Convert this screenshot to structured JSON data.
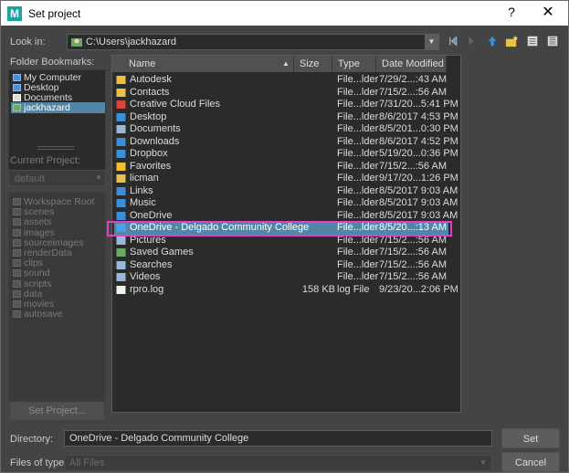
{
  "window": {
    "title": "Set project",
    "app_icon_letter": "M",
    "help": "?",
    "close": "✕"
  },
  "look_in": {
    "label": "Look in:",
    "path": "C:\\Users\\jackhazard"
  },
  "bookmarks": {
    "label": "Folder Bookmarks:",
    "items": [
      {
        "label": "My Computer"
      },
      {
        "label": "Desktop"
      },
      {
        "label": "Documents"
      },
      {
        "label": "jackhazard"
      }
    ]
  },
  "current_project": {
    "label": "Current Project:",
    "value": "default"
  },
  "workspace_items": [
    {
      "label": "Workspace Root"
    },
    {
      "label": "scenes"
    },
    {
      "label": "assets"
    },
    {
      "label": "images"
    },
    {
      "label": "sourceimages"
    },
    {
      "label": "renderData"
    },
    {
      "label": "clips"
    },
    {
      "label": "sound"
    },
    {
      "label": "scripts"
    },
    {
      "label": "data"
    },
    {
      "label": "movies"
    },
    {
      "label": "autosave"
    }
  ],
  "set_project_button": "Set Project...",
  "columns": {
    "name": "Name",
    "size": "Size",
    "type": "Type",
    "modified": "Date Modified"
  },
  "files": [
    {
      "name": "Autodesk",
      "size": "",
      "type": "File...lder",
      "date": "7/29/2...:43 AM",
      "icon": "#e8c04a"
    },
    {
      "name": "Contacts",
      "size": "",
      "type": "File...lder",
      "date": "7/15/2...:56 AM",
      "icon": "#e8c04a"
    },
    {
      "name": "Creative Cloud Files",
      "size": "",
      "type": "File...lder",
      "date": "7/31/20...5:41 PM",
      "icon": "#d8443a"
    },
    {
      "name": "Desktop",
      "size": "",
      "type": "File...lder",
      "date": "8/6/2017 4:53 PM",
      "icon": "#3a8fd8"
    },
    {
      "name": "Documents",
      "size": "",
      "type": "File...lder",
      "date": "8/5/201...0:30 PM",
      "icon": "#9ab8d8"
    },
    {
      "name": "Downloads",
      "size": "",
      "type": "File...lder",
      "date": "8/6/2017 4:52 PM",
      "icon": "#3a8fd8"
    },
    {
      "name": "Dropbox",
      "size": "",
      "type": "File...lder",
      "date": "5/19/20...0:36 PM",
      "icon": "#3a8fd8"
    },
    {
      "name": "Favorites",
      "size": "",
      "type": "File...lder",
      "date": "7/15/2...:56 AM",
      "icon": "#f0c030"
    },
    {
      "name": "licman",
      "size": "",
      "type": "File...lder",
      "date": "9/17/20...1:26 PM",
      "icon": "#e8c04a"
    },
    {
      "name": "Links",
      "size": "",
      "type": "File...lder",
      "date": "8/5/2017 9:03 AM",
      "icon": "#3a8fd8"
    },
    {
      "name": "Music",
      "size": "",
      "type": "File...lder",
      "date": "8/5/2017 9:03 AM",
      "icon": "#3a8fd8"
    },
    {
      "name": "OneDrive",
      "size": "",
      "type": "File...lder",
      "date": "8/5/2017 9:03 AM",
      "icon": "#3a8fd8"
    },
    {
      "name": "OneDrive - Delgado Community College",
      "size": "",
      "type": "File...lder",
      "date": "8/5/20...:13 AM",
      "icon": "#4aa0e8"
    },
    {
      "name": "Pictures",
      "size": "",
      "type": "File...lder",
      "date": "7/15/2...:56 AM",
      "icon": "#9ab8d8"
    },
    {
      "name": "Saved Games",
      "size": "",
      "type": "File...lder",
      "date": "7/15/2...:56 AM",
      "icon": "#6aa86a"
    },
    {
      "name": "Searches",
      "size": "",
      "type": "File...lder",
      "date": "7/15/2...:56 AM",
      "icon": "#9ab8d8"
    },
    {
      "name": "Videos",
      "size": "",
      "type": "File...lder",
      "date": "7/15/2...:56 AM",
      "icon": "#9ab8d8"
    },
    {
      "name": "rpro.log",
      "size": "158 KB",
      "type": "log File",
      "date": "9/23/20...2:06 PM",
      "icon": "#f0f0f0"
    }
  ],
  "directory": {
    "label": "Directory:",
    "value": "OneDrive - Delgado Community College"
  },
  "files_of_type": {
    "label": "Files of type:",
    "value": "All Files"
  },
  "buttons": {
    "set": "Set",
    "cancel": "Cancel"
  },
  "colors": {
    "selection": "#5285a6",
    "highlight_outline": "#e040c8",
    "background": "#444444"
  }
}
